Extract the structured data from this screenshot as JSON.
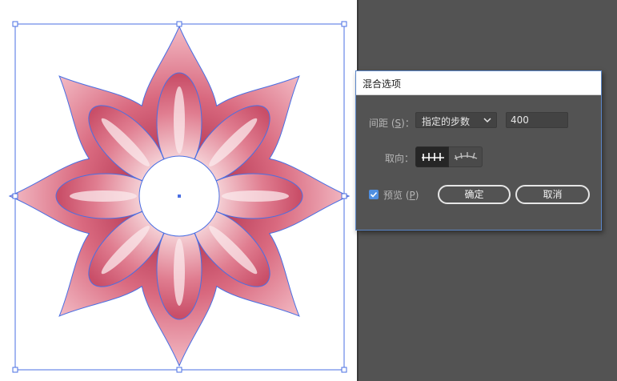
{
  "dialog": {
    "title": "混合选项",
    "spacing_label": "间距",
    "spacing_shortcut": "S",
    "spacing_value": "指定的步数",
    "steps_value": "400",
    "orientation_label": "取向：",
    "preview_label": "预览",
    "preview_shortcut": "P",
    "preview_checked": true,
    "ok_label": "确定",
    "cancel_label": "取消"
  },
  "colors": {
    "selection": "#4a6fe3",
    "petal_edge": "#e58a98",
    "petal_deep": "#b93a57",
    "dialog_bg": "#535353",
    "checkbox": "#4f8fe0"
  },
  "icons": {
    "dropdown": "chevron-down-icon",
    "orient_page": "align-to-page-icon",
    "orient_path": "align-to-path-icon",
    "checkbox": "checkmark-icon"
  }
}
